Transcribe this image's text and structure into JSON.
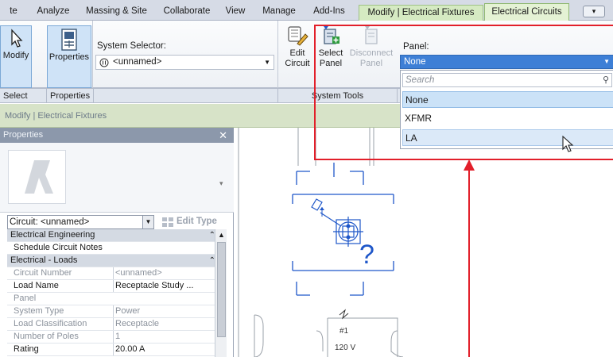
{
  "tabs": [
    {
      "label": "te"
    },
    {
      "label": "Analyze"
    },
    {
      "label": "Massing & Site"
    },
    {
      "label": "Collaborate"
    },
    {
      "label": "View"
    },
    {
      "label": "Manage"
    },
    {
      "label": "Add-Ins"
    },
    {
      "label": "Modify | Electrical Fixtures"
    },
    {
      "label": "Electrical Circuits"
    }
  ],
  "tab_menu": "▾",
  "ribbon": {
    "modify_label": "Modify",
    "properties_label": "Properties",
    "system_selector_label": "System Selector:",
    "system_selector_value": "<unnamed>",
    "edit_circuit_line1": "Edit",
    "edit_circuit_line2": "Circuit",
    "select_panel_line1": "Select",
    "select_panel_line2": "Panel",
    "disconnect_panel_line1": "Disconnect",
    "disconnect_panel_line2": "Panel",
    "groups": {
      "select": "Select",
      "properties": "Properties",
      "system_tools": "System Tools"
    },
    "panel_label": "Panel:",
    "panel_value": "None",
    "panel_search_placeholder": "Search",
    "panel_options": [
      {
        "label": "None"
      },
      {
        "label": "XFMR"
      },
      {
        "label": "LA"
      }
    ]
  },
  "breadcrumb": "Modify | Electrical Fixtures",
  "properties": {
    "title": "Properties",
    "close": "✕",
    "circuit_selector": "Circuit: <unnamed>",
    "edit_type": "Edit Type",
    "rows": [
      {
        "key": "Electrical Engineering",
        "value": "",
        "category": true
      },
      {
        "key": "Schedule Circuit Notes",
        "value": "",
        "category": false,
        "dim": false
      },
      {
        "key": "Electrical - Loads",
        "value": "",
        "category": true
      },
      {
        "key": "Circuit Number",
        "value": "<unnamed>",
        "category": false,
        "dim": true
      },
      {
        "key": "Load Name",
        "value": "Receptacle Study ...",
        "category": false,
        "dim": false
      },
      {
        "key": "Panel",
        "value": "",
        "category": false,
        "dim": true
      },
      {
        "key": "System Type",
        "value": "Power",
        "category": false,
        "dim": true
      },
      {
        "key": "Load Classification",
        "value": "Receptacle",
        "category": false,
        "dim": true
      },
      {
        "key": "Number of Poles",
        "value": "1",
        "category": false,
        "dim": true
      },
      {
        "key": "Rating",
        "value": "20.00 A",
        "category": false,
        "dim": false
      }
    ]
  },
  "canvas": {
    "question_mark": "?",
    "tag_number": "#1",
    "tag_voltage": "120 V"
  },
  "colors": {
    "annotation_red": "#e21f2a",
    "selection_blue": "#3d7fd6",
    "context_tab_green": "#d5eac2",
    "element_blue": "#1f57c9"
  }
}
